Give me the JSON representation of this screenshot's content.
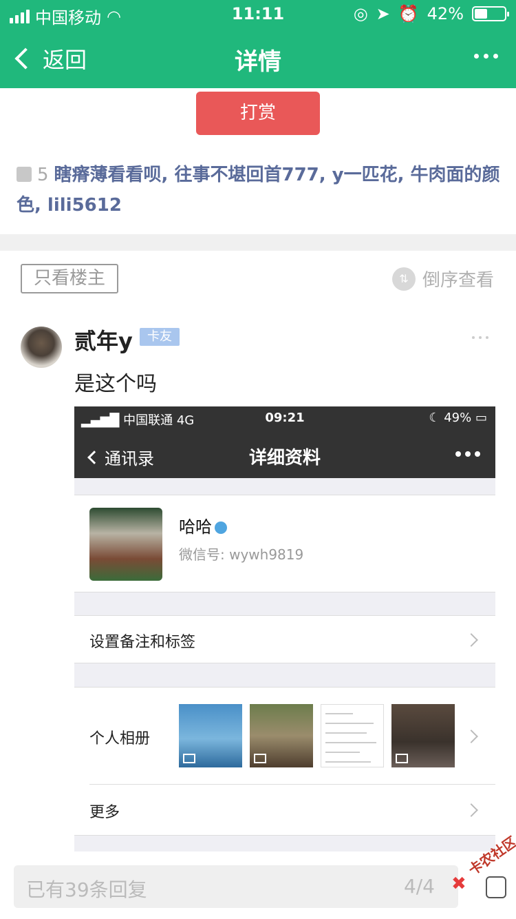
{
  "status_bar": {
    "carrier": "中国移动",
    "time": "11:11",
    "battery": "42%",
    "battery_level": 0.42
  },
  "nav": {
    "back_label": "返回",
    "title": "详情"
  },
  "reward_button": "打赏",
  "likes": {
    "count": "5",
    "names": "瞎瘠薄看看呗, 往事不堪回首777, y一匹花, 牛肉面的颜色, lili5612"
  },
  "filters": {
    "only_op": "只看楼主",
    "reverse": "倒序查看"
  },
  "post": {
    "username": "贰年y",
    "badge": "卡友",
    "text": "是这个吗"
  },
  "screenshot": {
    "status": {
      "carrier": "中国联通",
      "network": "4G",
      "time": "09:21",
      "battery": "49%"
    },
    "nav": {
      "back_label": "通讯录",
      "title": "详细资料"
    },
    "profile": {
      "name": "哈哈",
      "wechat_id": "微信号: wywh9819"
    },
    "rows": {
      "remark": "设置备注和标签",
      "album": "个人相册",
      "more": "更多"
    }
  },
  "reply_bar": {
    "placeholder": "已有39条回复",
    "page": "4/4"
  },
  "watermark": "卡农社区",
  "colors": {
    "brand_green": "#20b87c",
    "reward_red": "#e95858",
    "like_name_blue": "#5a6b9a"
  }
}
